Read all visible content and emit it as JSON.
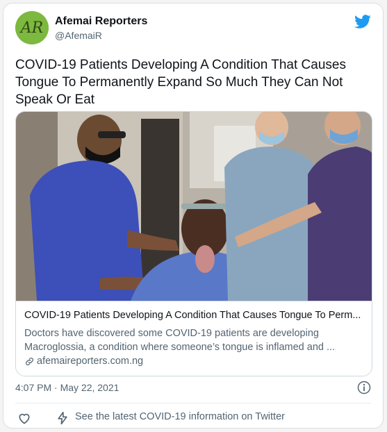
{
  "account": {
    "name": "Afemai Reporters",
    "handle": "@AfemaiR",
    "avatar_text": "AR"
  },
  "tweet": {
    "text": "COVID-19 Patients Developing A Condition That Causes Tongue To Permanently Expand So Much They Can Not Speak Or Eat"
  },
  "link_card": {
    "title": "COVID-19 Patients Developing A Condition That Causes Tongue To Perm...",
    "description": "Doctors have discovered some COVID-19 patients are developing Macroglossia, a condition where someone’s tongue is inflamed and ...",
    "domain": "afemaireporters.com.ng"
  },
  "meta": {
    "timestamp": "4:07 PM · May 22, 2021"
  },
  "actions": {
    "covid_info": "See the latest COVID-19 information on Twitter"
  },
  "colors": {
    "twitter_blue": "#1d9bf0",
    "avatar_green": "#7db83f",
    "text_primary": "#0f1419",
    "text_secondary": "#536471"
  },
  "icons": [
    "twitter-bird-icon",
    "link-icon",
    "info-icon",
    "heart-icon",
    "lightning-bolt-icon"
  ]
}
